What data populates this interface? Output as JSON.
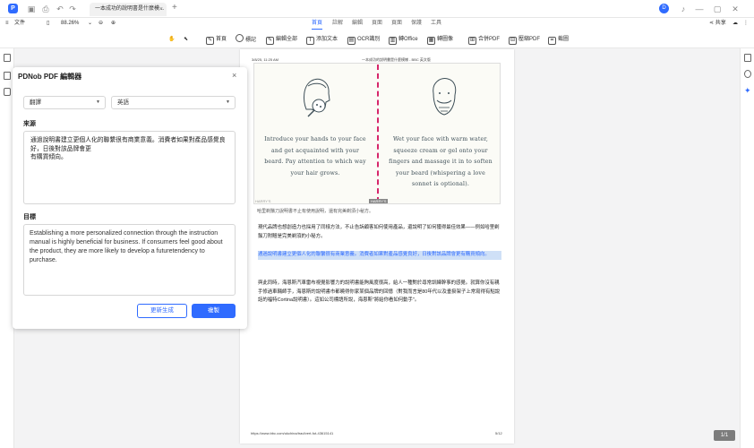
{
  "titlebar": {
    "tab_title": "一本成功的說明書是什麼模...",
    "tab_close": "×",
    "new_tab": "+",
    "avatar_letter": "D",
    "window_controls": [
      "—",
      "▢",
      "✕"
    ]
  },
  "menubar": {
    "file": "文件",
    "zoom": "88.26%",
    "tabs": [
      "首頁",
      "註解",
      "編輯",
      "頁面",
      "頁面",
      "保護",
      "工具"
    ],
    "active_tab": "首頁",
    "share": "共享"
  },
  "toolbar": {
    "items": [
      "首頁",
      "標記",
      "編輯全部",
      "添加文本",
      "OCR識別",
      "轉Office",
      "轉圖像",
      "合併PDF",
      "壓縮PDF",
      "截圖"
    ]
  },
  "panel": {
    "title": "PDNob PDF 編輯器",
    "close": "×",
    "mode_select": "翻譯",
    "lang_select": "英語",
    "source_label": "來源",
    "source_text": "通過說明書建立更個人化的聯繫很有商業意義。消費者如果對產品感覺良好，日後對該品牌會更\n有購買傾向。",
    "target_label": "目標",
    "target_text": "Establishing a more personalized connection through the instruction manual is highly beneficial for business. If consumers feel good about the product, they are more likely to develop a futuretendency to purchase.",
    "regen_button": "更新生成",
    "copy_button": "複製"
  },
  "page": {
    "header_left": "3/8/25, 11:25 AM",
    "header_right": "一本成功的說明書是什麼模樣 - BBC 英文版",
    "illus_left_text": "Introduce your hands to your face and get acquainted with your beard. Pay attention to which way your hair grows.",
    "illus_right_text": "Wet your face with warm water, squeeze cream or gel onto your fingers and massage it in to soften your beard (whispering a love sonnet is optional).",
    "illus_credit": "HARRY'S",
    "illus_tag": "HARRY'S",
    "caption": "哈里剃鬚刀說明書不止有使用說明，還有完美剃須小秘方。",
    "para1": "現代品牌也想創造力也採用了同樣方法，不止告訴顧客如何使用產品，還說明了如何獲得最佳效果——例如哈里剃鬚刀附贈是完美剃須的小秘方。",
    "para2": "通過說明書建立更個人化的聯繫很有商業意義。消費者如果對產品感覺良好，日後對該品牌會更有購買傾向。",
    "para3": "與此同時，海恩斯汽車雷布視覺影響力的說明書能夠風度很高，給人一種對於尋常訓練幹事的感覺。就算你沒有親手修過車輛師手，海恩斯的說明書市都曉得你家某個品牌的回憶（對我而言是80年代以及垂掛架子上常寫得有點說話的福特Cortina說明書）。這如公司標語所說，海恩斯\"將給你看如何動手\"。",
    "url": "https://www.bbc.com/ukchina/trad/vert-fut-43615141",
    "page_num": "5/12"
  },
  "page_counter": "1/1",
  "colors": {
    "accent": "#2f6bff",
    "divider": "#d6266b",
    "highlight": "#cfe0f7"
  }
}
